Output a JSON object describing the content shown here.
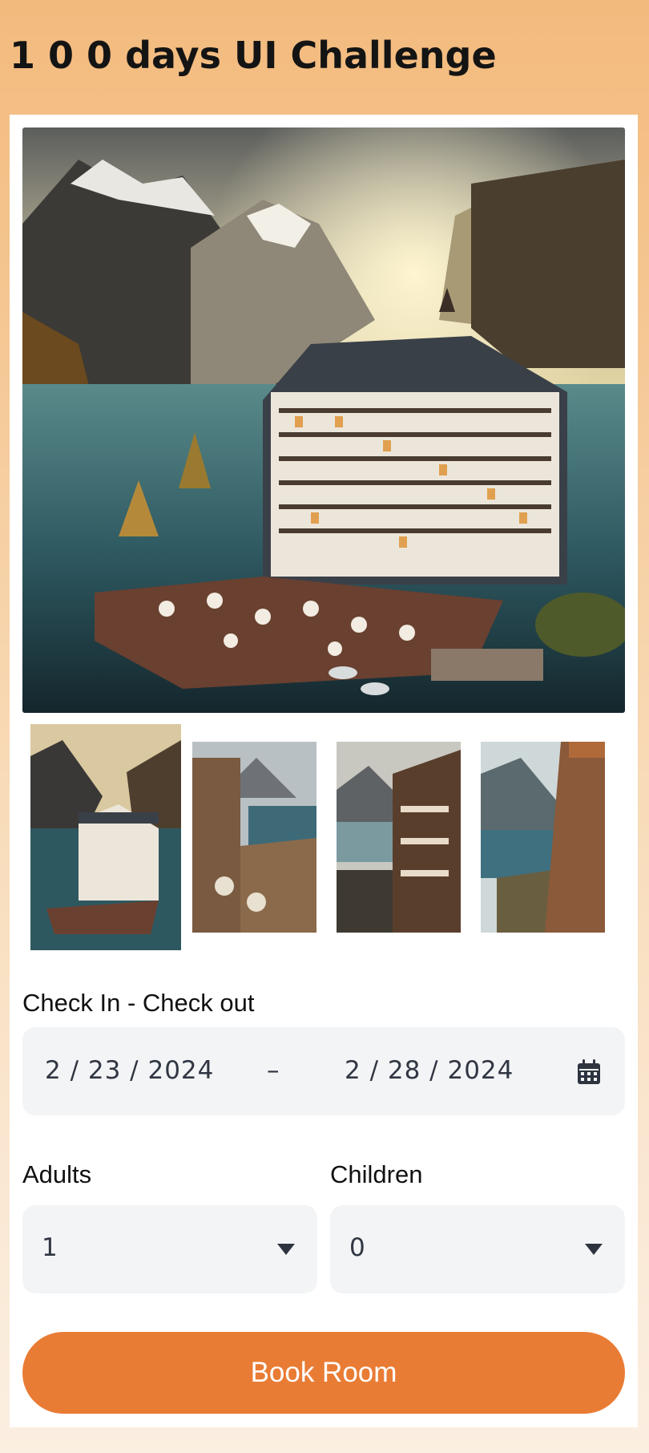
{
  "header": {
    "title": "1 0 0 days UI Challenge"
  },
  "gallery": {
    "hero_alt": "Lakeside alpine hotel at sunset",
    "thumbnails": [
      {
        "name": "thumbnail-1",
        "active": true
      },
      {
        "name": "thumbnail-2",
        "active": false
      },
      {
        "name": "thumbnail-3",
        "active": false
      },
      {
        "name": "thumbnail-4",
        "active": false
      }
    ]
  },
  "booking": {
    "dates_label": "Check In - Check out",
    "check_in": "2 / 23 / 2024",
    "separator": "–",
    "check_out": "2 / 28 / 2024",
    "calendar_icon": "calendar-icon",
    "adults_label": "Adults",
    "adults_value": "1",
    "children_label": "Children",
    "children_value": "0",
    "dropdown_icon": "caret-down-icon",
    "book_label": "Book Room"
  },
  "colors": {
    "accent": "#e97c35",
    "background_top": "#f3ba7d",
    "field_bg": "#f3f4f6"
  }
}
